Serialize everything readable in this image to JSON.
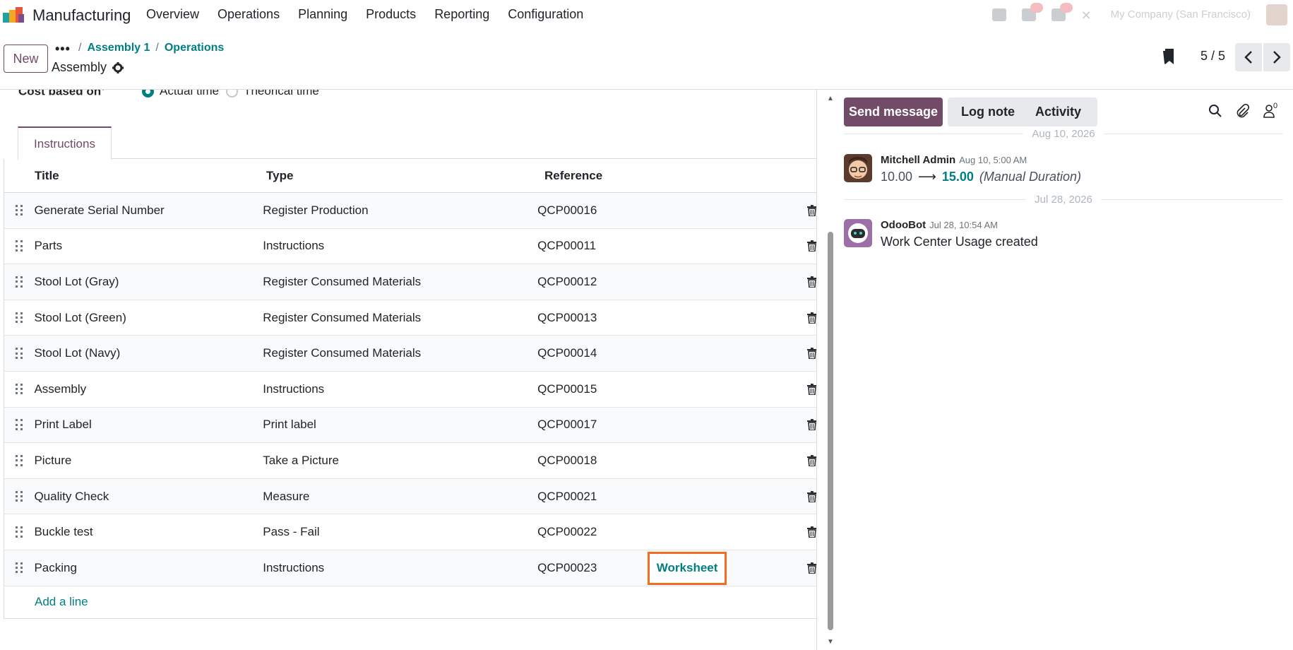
{
  "navbar": {
    "app_name": "Manufacturing",
    "menu": [
      "Overview",
      "Operations",
      "Planning",
      "Products",
      "Reporting",
      "Configuration"
    ],
    "company": "My Company (San Francisco)"
  },
  "control": {
    "new_label": "New",
    "breadcrumbs": [
      "Assembly 1",
      "Operations"
    ],
    "record_title": "Assembly",
    "pager": "5 / 5"
  },
  "form": {
    "cost_label": "Cost based on",
    "cost_required": "?",
    "options": [
      "Actual time",
      "Theorical time"
    ],
    "tab": "Instructions",
    "columns": [
      "Title",
      "Type",
      "Reference"
    ],
    "rows": [
      {
        "title": "Generate Serial Number",
        "type": "Register Production",
        "ref": "QCP00016"
      },
      {
        "title": "Parts",
        "type": "Instructions",
        "ref": "QCP00011"
      },
      {
        "title": "Stool Lot (Gray)",
        "type": "Register Consumed Materials",
        "ref": "QCP00012"
      },
      {
        "title": "Stool Lot (Green)",
        "type": "Register Consumed Materials",
        "ref": "QCP00013"
      },
      {
        "title": "Stool Lot (Navy)",
        "type": "Register Consumed Materials",
        "ref": "QCP00014"
      },
      {
        "title": "Assembly",
        "type": "Instructions",
        "ref": "QCP00015"
      },
      {
        "title": "Print Label",
        "type": "Print label",
        "ref": "QCP00017"
      },
      {
        "title": "Picture",
        "type": "Take a Picture",
        "ref": "QCP00018"
      },
      {
        "title": "Quality Check",
        "type": "Measure",
        "ref": "QCP00021"
      },
      {
        "title": "Buckle test",
        "type": "Pass - Fail",
        "ref": "QCP00022"
      },
      {
        "title": "Packing",
        "type": "Instructions",
        "ref": "QCP00023",
        "worksheet": "Worksheet"
      }
    ],
    "add_line": "Add a line"
  },
  "chatter": {
    "send_message": "Send message",
    "log_note": "Log note",
    "activity": "Activity",
    "followers_count": "0",
    "date1": "Aug 10, 2026",
    "msg1": {
      "author": "Mitchell Admin",
      "date": "Aug 10, 5:00 AM",
      "old": "10.00",
      "new": "15.00",
      "field": "(Manual Duration)"
    },
    "date2": "Jul 28, 2026",
    "msg2": {
      "author": "OdooBot",
      "date": "Jul 28, 10:54 AM",
      "body": "Work Center Usage created"
    }
  },
  "colors": {
    "brand": "#714b67",
    "link": "#017e84",
    "highlight": "#f26d21"
  }
}
